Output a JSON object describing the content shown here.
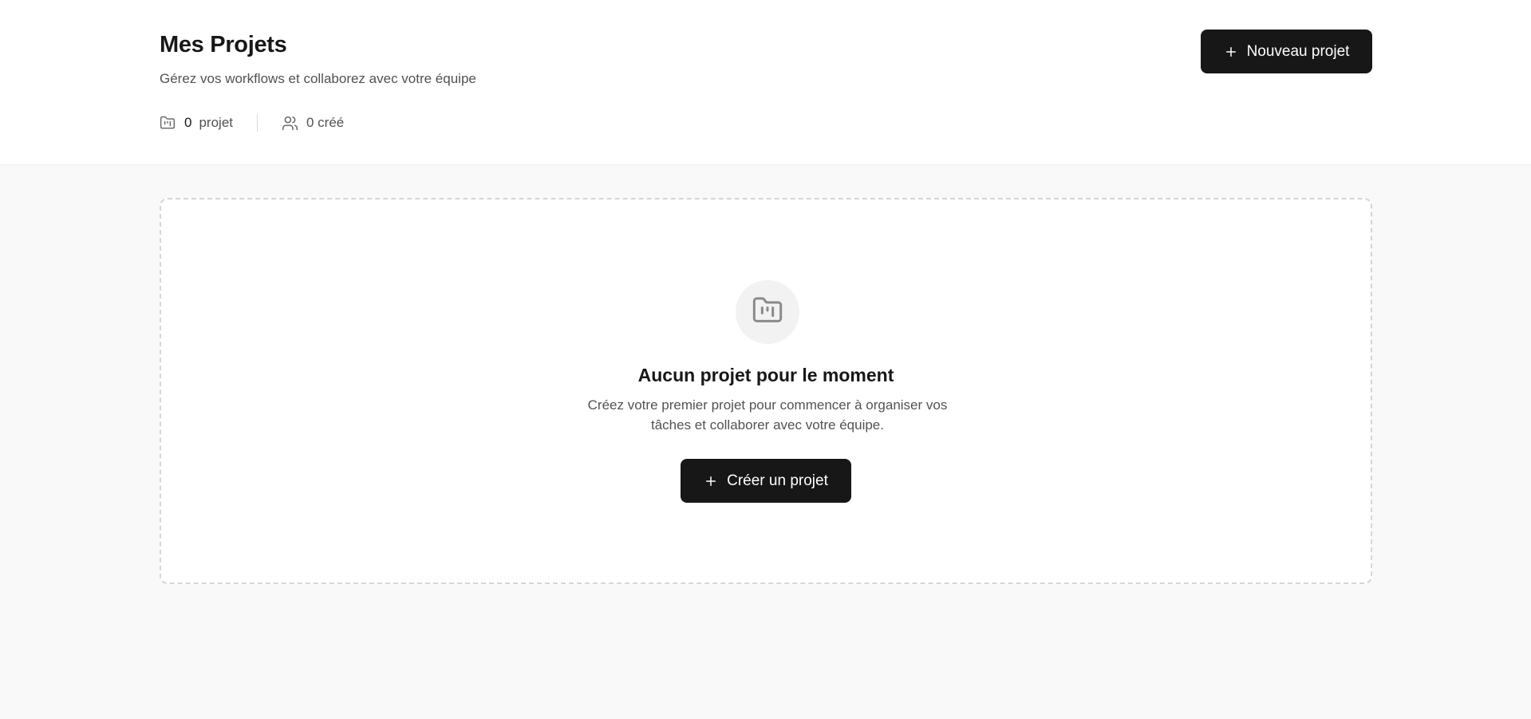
{
  "header": {
    "title": "Mes Projets",
    "subtitle": "Gérez vos workflows et collaborez avec votre équipe",
    "stats": {
      "projects_count": "0",
      "projects_label": "projet",
      "projects_icon": "folder-kanban-icon",
      "created_label": "0 créé",
      "created_icon": "users-icon"
    },
    "new_project_button": {
      "label": "Nouveau projet",
      "icon": "plus-icon"
    }
  },
  "empty_state": {
    "icon": "folder-kanban-icon",
    "title": "Aucun projet pour le moment",
    "description": "Créez votre premier projet pour commencer à organiser vos tâches et collaborer avec votre équipe.",
    "create_button": {
      "label": "Créer un projet",
      "icon": "plus-icon"
    }
  },
  "colors": {
    "primary_button": "#171717",
    "page_background": "#f9f9f9",
    "card_border": "#d6d6d6",
    "muted_text": "#525252"
  }
}
